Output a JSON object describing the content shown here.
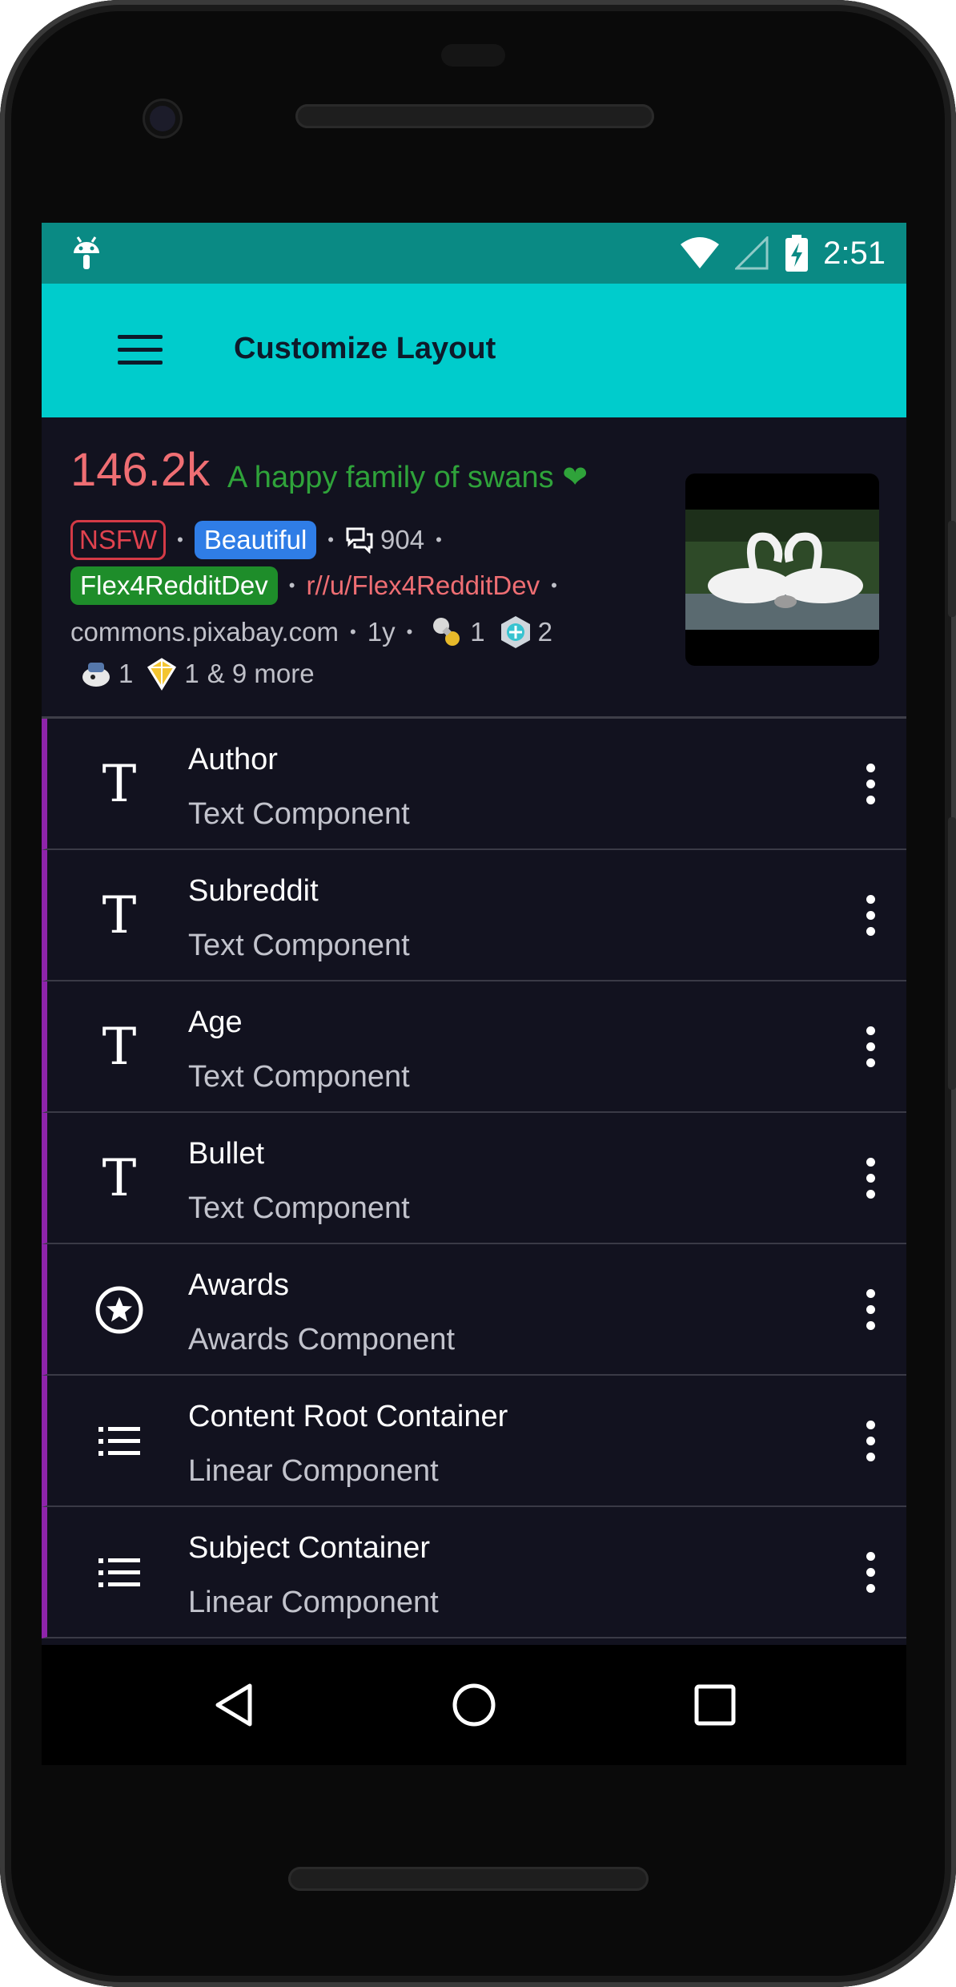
{
  "status": {
    "time": "2:51"
  },
  "appbar": {
    "title": "Customize Layout",
    "menu_icon": "hamburger-menu-icon"
  },
  "preview": {
    "score": "146.2k",
    "title": "A happy family of swans",
    "title_emoji": "❤",
    "nsfw_label": "NSFW",
    "flair": "Beautiful",
    "comments": "904",
    "author": "Flex4RedditDev",
    "subreddit": "r//u/Flex4RedditDev",
    "domain": "commons.pixabay.com",
    "age": "1y",
    "award1_count": "1",
    "award2_count": "2",
    "award3_count": "1",
    "award4_count": "1",
    "more_awards": "& 9 more",
    "bullet": "•"
  },
  "components": [
    {
      "title": "Author",
      "subtitle": "Text Component",
      "icon": "text-t-icon"
    },
    {
      "title": "Subreddit",
      "subtitle": "Text Component",
      "icon": "text-t-icon"
    },
    {
      "title": "Age",
      "subtitle": "Text Component",
      "icon": "text-t-icon"
    },
    {
      "title": "Bullet",
      "subtitle": "Text Component",
      "icon": "text-t-icon"
    },
    {
      "title": "Awards",
      "subtitle": "Awards Component",
      "icon": "star-circle-icon"
    },
    {
      "title": "Content Root Container",
      "subtitle": "Linear Component",
      "icon": "list-icon"
    },
    {
      "title": "Subject Container",
      "subtitle": "Linear Component",
      "icon": "list-icon"
    }
  ],
  "colors": {
    "statusbar": "#0a8a84",
    "appbar": "#00cccc",
    "background": "#12121f",
    "accent_bar": "#8e24aa",
    "score": "#ef6e73",
    "title": "#2fa33a"
  }
}
